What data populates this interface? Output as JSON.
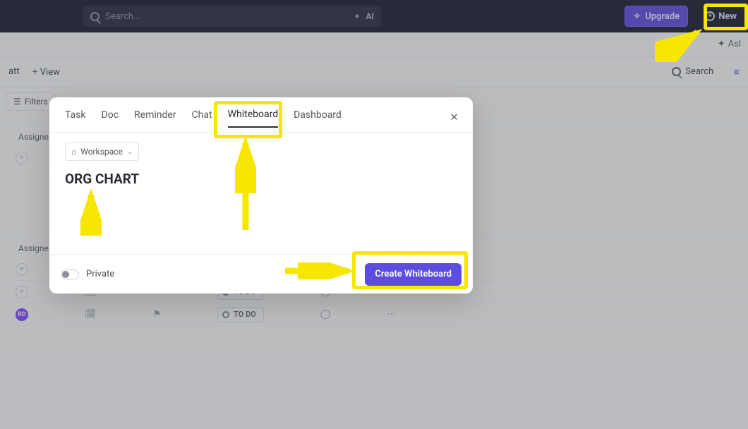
{
  "topbar": {
    "search_placeholder": "Search...",
    "ai_label": "AI",
    "upgrade": "Upgrade",
    "new": "New"
  },
  "subbar": {
    "ask": "Asl"
  },
  "viewbar": {
    "att": "att",
    "view": "View",
    "search": "Search"
  },
  "filters": {
    "label": "Filters"
  },
  "sections": {
    "assignee": "Assigne"
  },
  "status": {
    "todo": "TO DO"
  },
  "avatar": {
    "initials": "RD"
  },
  "modal": {
    "tabs": [
      "Task",
      "Doc",
      "Reminder",
      "Chat",
      "Whiteboard",
      "Dashboard"
    ],
    "active_tab": "Whiteboard",
    "workspace_label": "Workspace",
    "title_value": "ORG CHART",
    "private_label": "Private",
    "create_label": "Create Whiteboard"
  }
}
